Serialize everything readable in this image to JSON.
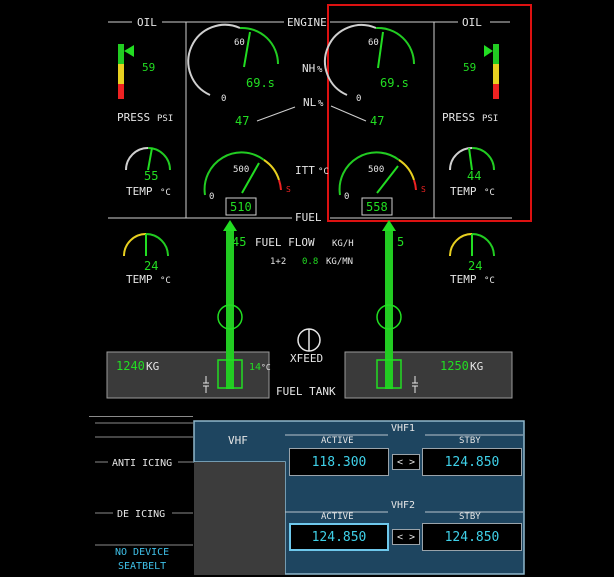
{
  "engine_panel": {
    "oil_left": "OIL",
    "oil_right": "OIL",
    "engine": "ENGINE",
    "oil_press_left_value": "59",
    "oil_press_right_value": "59",
    "press_label": "PRESS",
    "psi_unit": "PSI",
    "nh_label": "NH",
    "nh_unit": "%",
    "nl_label": "NL",
    "nl_unit": "%",
    "nh_left_value": "69.s",
    "nh_right_value": "69.s",
    "nh_scale_max": "60",
    "nh_scale_min": "0",
    "nl_left_value": "47",
    "nl_right_value": "47",
    "oil_temp_left_value": "55",
    "oil_temp_right_value": "44",
    "temp_label": "TEMP",
    "celsius_unit": "°C",
    "itt_label": "ITT",
    "itt_unit": "°C",
    "itt_scale_mid": "500",
    "itt_scale_min": "0",
    "itt_limit_mark": "S",
    "itt_left_value": "510",
    "itt_right_value": "558",
    "fuel_label": "FUEL",
    "fuel_flow_label": "FUEL FLOW",
    "fuel_flow_unit": "KG/H",
    "fuel_flow_left": "45",
    "fuel_flow_right": "5",
    "sum_label": "1+2",
    "sum_value": "0.8",
    "sum_unit": "KG/MN",
    "fuel_temp_left_value": "24",
    "fuel_temp_right_value": "24",
    "xfeed_label": "XFEED",
    "fuel_tank_label": "FUEL TANK",
    "tank_left_qty": "1240",
    "tank_right_qty": "1250",
    "kg_unit": "KG",
    "tank_temp": "14",
    "tank_temp_unit": "°C"
  },
  "status": {
    "anti_icing": "ANTI ICING",
    "de_icing": "DE ICING",
    "no_device_line1": "NO DEVICE",
    "no_device_line2": "SEATBELT"
  },
  "vhf": {
    "tab_label": "VHF",
    "vhf1_title": "VHF1",
    "vhf2_title": "VHF2",
    "active_label": "ACTIVE",
    "stby_label": "STBY",
    "vhf1_active": "118.300",
    "vhf1_stby": "124.850",
    "vhf2_active": "124.850",
    "vhf2_stby": "124.850",
    "swap_symbol": "< >"
  },
  "colors": {
    "background": "#000000",
    "text_white": "#e6e6e6",
    "value_green": "#22dd22",
    "freq_cyan": "#3fd0e8",
    "panel_blue": "#1e4560",
    "highlight_red": "#dd1111",
    "caution_amber": "#e8d020",
    "warning_red": "#ee2222"
  }
}
